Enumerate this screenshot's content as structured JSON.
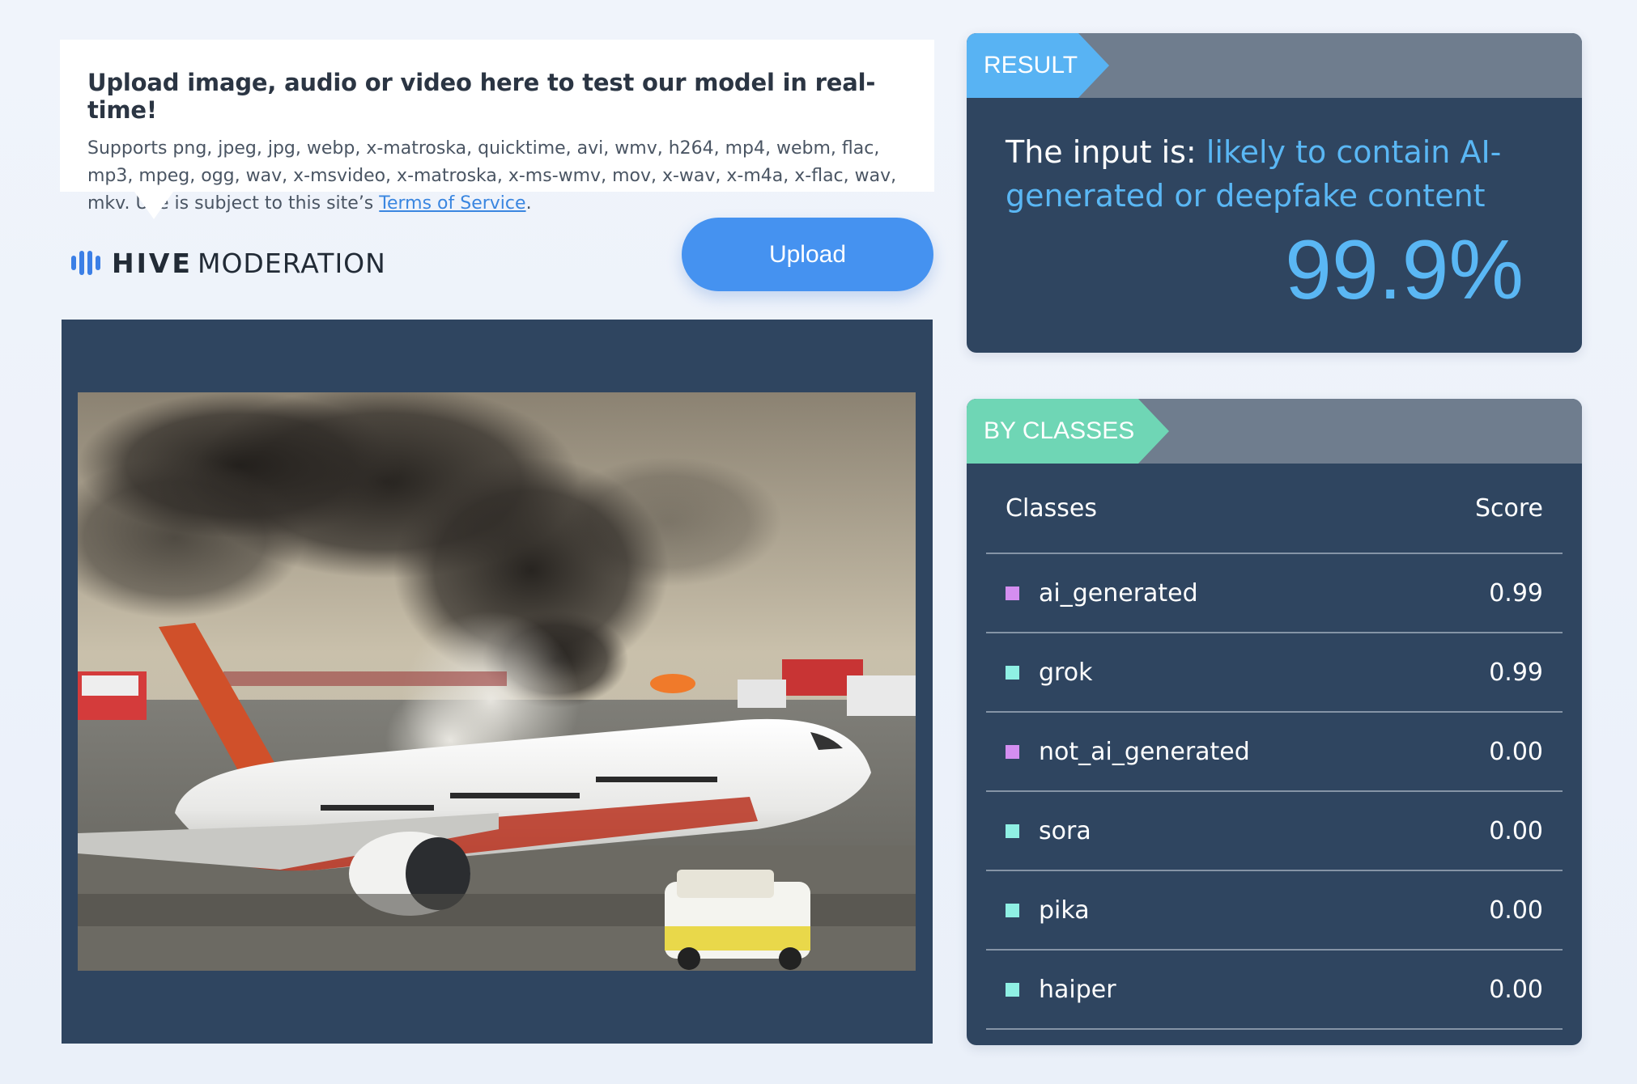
{
  "tooltip": {
    "title": "Upload image, audio or video here to test our model in real-time!",
    "description_prefix": "Supports png, jpeg, jpg, webp, x-matroska, quicktime, avi, wmv, h264, mp4, webm, flac, mp3, mpeg, ogg, wav, x-msvideo, x-matroska, x-ms-wmv, mov, x-wav, x-m4a, x-flac, wav, mkv. Use is subject to this site’s ",
    "link_text": "Terms of Service",
    "description_suffix": "."
  },
  "logo": {
    "brand": "HIVE",
    "product": "MODERATION",
    "color": "#3b7fe6"
  },
  "upload_button": {
    "label": "Upload",
    "color": "#4592f0"
  },
  "result": {
    "tag": "RESULT",
    "prefix": "The input is: ",
    "verdict": "likely to contain AI-generated or deepfake content",
    "percent": "99.9%",
    "accent_color": "#5ab7f4"
  },
  "classes": {
    "tag": "BY CLASSES",
    "header_classes": "Classes",
    "header_score": "Score",
    "rows": [
      {
        "name": "ai_generated",
        "score": "0.99",
        "swatch": "#d48ef0"
      },
      {
        "name": "grok",
        "score": "0.99",
        "swatch": "#8ff0e4"
      },
      {
        "name": "not_ai_generated",
        "score": "0.00",
        "swatch": "#d48ef0"
      },
      {
        "name": "sora",
        "score": "0.00",
        "swatch": "#8ff0e4"
      },
      {
        "name": "pika",
        "score": "0.00",
        "swatch": "#8ff0e4"
      },
      {
        "name": "haiper",
        "score": "0.00",
        "swatch": "#8ff0e4"
      }
    ]
  }
}
